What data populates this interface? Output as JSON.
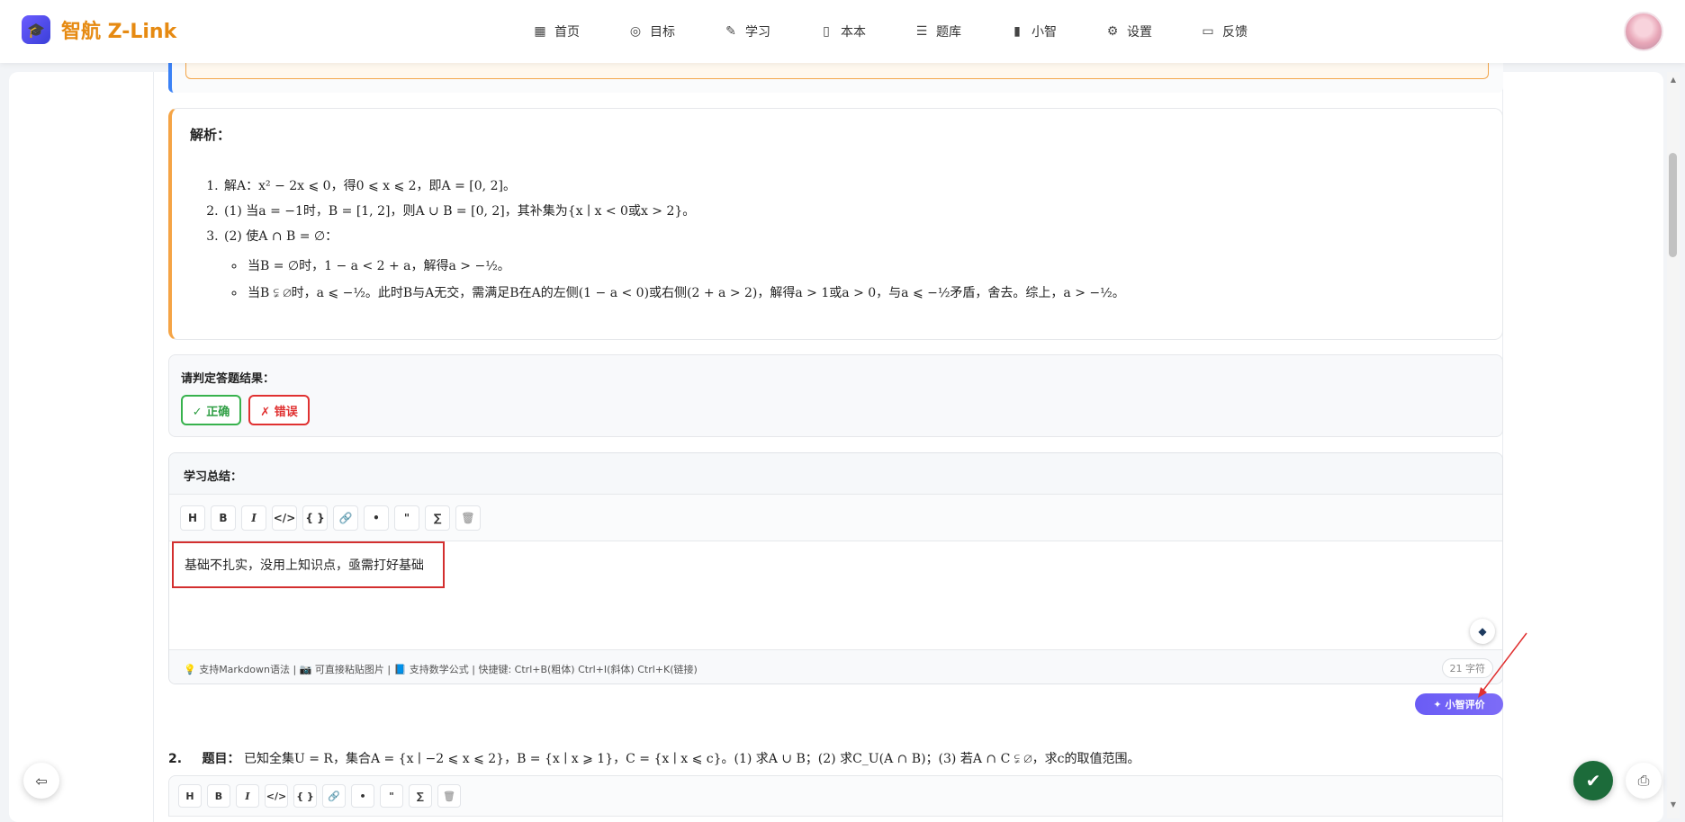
{
  "brand": {
    "name": "智航 Z-Link"
  },
  "nav": {
    "items": [
      {
        "label": "首页",
        "icon": "grid-icon"
      },
      {
        "label": "目标",
        "icon": "target-icon"
      },
      {
        "label": "学习",
        "icon": "edit-icon"
      },
      {
        "label": "本本",
        "icon": "book-icon"
      },
      {
        "label": "题库",
        "icon": "list-icon"
      },
      {
        "label": "小智",
        "icon": "bar-chart-icon"
      },
      {
        "label": "设置",
        "icon": "gear-icon"
      },
      {
        "label": "反馈",
        "icon": "message-icon"
      }
    ]
  },
  "analysis": {
    "title": "解析：",
    "steps": [
      "解A：x² − 2x ⩽ 0，得0 ⩽ x ⩽ 2，即A = [0, 2]。",
      "(1) 当a = −1时，B = [1, 2]，则A ∪ B = [0, 2]，其补集为{x ∣ x < 0或x > 2}。",
      "(2) 使A ∩ B = ∅："
    ],
    "substeps": [
      "当B = ∅时，1 − a < 2 + a，解得a > −½。",
      "当B ⫋ ∅时，a ⩽ −½。此时B与A无交，需满足B在A的左侧(1 − a < 0)或右侧(2 + a > 2)，解得a > 1或a > 0，与a ⩽ −½矛盾，舍去。综上，a > −½。"
    ]
  },
  "judge": {
    "title": "请判定答题结果：",
    "correct_label": "✓ 正确",
    "wrong_label": "✗ 错误"
  },
  "summary": {
    "title": "学习总结：",
    "toolbar": [
      "H",
      "B",
      "I",
      "</>",
      "{ }",
      "🔗",
      "•",
      "\"",
      "∑",
      "🗑"
    ],
    "content": "基础不扎实，没用上知识点，亟需打好基础",
    "footer": "💡 支持Markdown语法 | 📷 可直接粘贴图片 | 📘 支持数学公式 | 快捷键: Ctrl+B(粗体) Ctrl+I(斜体) Ctrl+K(链接)",
    "char_count": "21 字符"
  },
  "ai_eval_label": "小智评价",
  "question2": {
    "number": "2.",
    "label": "题目：",
    "text": "已知全集U = R，集合A = {x ∣ −2 ⩽ x ⩽ 2}，B = {x ∣ x ⩾ 1}，C = {x ∣ x ⩽ c}。(1) 求A ∪ B；(2) 求C_U(A ∩ B)；(3) 若A ∩ C ⫋ ∅，求c的取值范围。",
    "toolbar": [
      "H",
      "B",
      "I",
      "</>",
      "{ }",
      "🔗",
      "•",
      "\"",
      "∑",
      "🗑"
    ]
  },
  "colors": {
    "brand": "#e68a12",
    "analysis_accent": "#f5a445",
    "correct": "#2f9e44",
    "wrong": "#e03131",
    "ai_button": "#6a5cf5",
    "check_button": "#1c6b3a"
  }
}
